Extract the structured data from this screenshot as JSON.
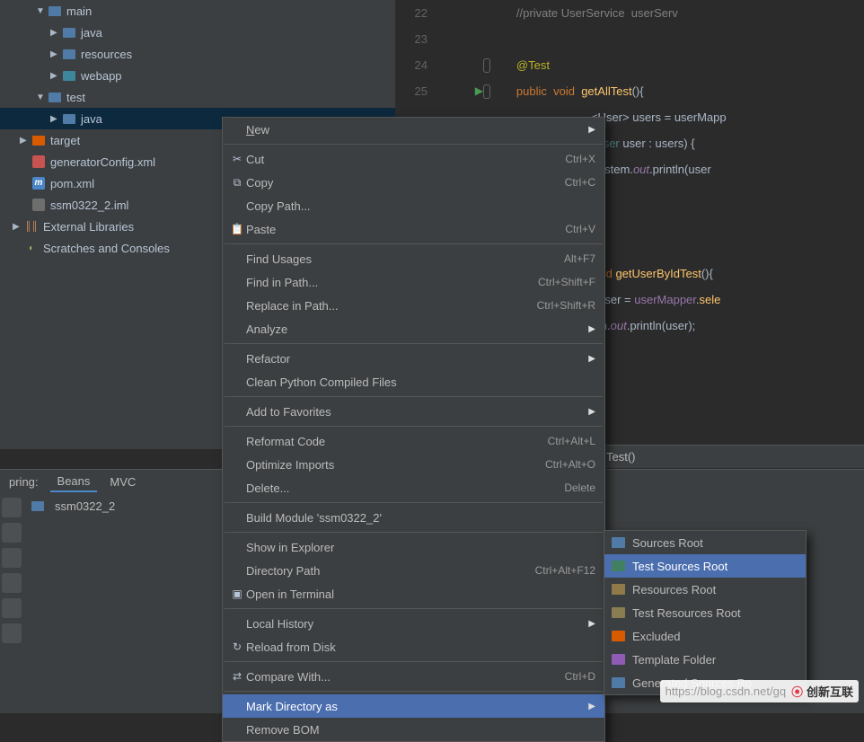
{
  "tree": {
    "main": "main",
    "main_java": "java",
    "main_res": "resources",
    "main_web": "webapp",
    "test": "test",
    "test_java": "java",
    "target": "target",
    "genxml": "generatorConfig.xml",
    "pom": "pom.xml",
    "iml": "ssm0322_2.iml",
    "extlibs": "External Libraries",
    "scratches": "Scratches and Consoles"
  },
  "editor": {
    "lines": {
      "l22": "22",
      "l23": "23",
      "l24": "24",
      "l25": "25"
    },
    "code": {
      "comment22": "//private UserService  userServ",
      "test_anno": "@Test",
      "public": "public",
      "void": "void",
      "getAllTest": "getAllTest",
      "sig_end": "(){",
      "frag_users": "<User> users = userMapp",
      "frag_for_pre": "(",
      "frag_for_type": "User",
      "frag_for_rest": " user : users) {",
      "frag_sys": "System.",
      "frag_out": "out",
      "frag_println": ".println(user",
      "getUserById": "getUserByIdTest",
      "sig_end2": "(){",
      "frag_user_pre": "• user = ",
      "frag_user_call": "userMapper",
      "frag_user_dot": ".",
      "frag_user_sel": "sele",
      "frag_em_pre": "em.",
      "frag_em_p": ".println(user);"
    },
    "breadcrumb_tail": "Test()"
  },
  "bottom": {
    "label": "pring:",
    "tab_beans": "Beans",
    "tab_mvc": "MVC",
    "bean_item": "ssm0322_2"
  },
  "menu": {
    "new": "New",
    "cut": "Cut",
    "cut_sc": "Ctrl+X",
    "copy": "Copy",
    "copy_sc": "Ctrl+C",
    "copy_path": "Copy Path...",
    "paste": "Paste",
    "paste_sc": "Ctrl+V",
    "find_usages": "Find Usages",
    "find_usages_sc": "Alt+F7",
    "find_path": "Find in Path...",
    "find_path_sc": "Ctrl+Shift+F",
    "replace_path": "Replace in Path...",
    "replace_path_sc": "Ctrl+Shift+R",
    "analyze": "Analyze",
    "refactor": "Refactor",
    "clean_py": "Clean Python Compiled Files",
    "add_fav": "Add to Favorites",
    "reformat": "Reformat Code",
    "reformat_sc": "Ctrl+Alt+L",
    "optimize": "Optimize Imports",
    "optimize_sc": "Ctrl+Alt+O",
    "delete": "Delete...",
    "delete_sc": "Delete",
    "build": "Build Module 'ssm0322_2'",
    "explorer": "Show in Explorer",
    "dir_path": "Directory Path",
    "dir_path_sc": "Ctrl+Alt+F12",
    "terminal": "Open in Terminal",
    "local_hist": "Local History",
    "reload": "Reload from Disk",
    "compare": "Compare With...",
    "compare_sc": "Ctrl+D",
    "mark_dir": "Mark Directory as",
    "remove_bom": "Remove BOM"
  },
  "submenu": {
    "sources": "Sources Root",
    "test_sources": "Test Sources Root",
    "resources": "Resources Root",
    "test_resources": "Test Resources Root",
    "excluded": "Excluded",
    "template": "Template Folder",
    "generated": "Generated Sources Ro"
  },
  "watermark": {
    "url": "https://blog.csdn.net/gq",
    "brand": "创新互联"
  }
}
